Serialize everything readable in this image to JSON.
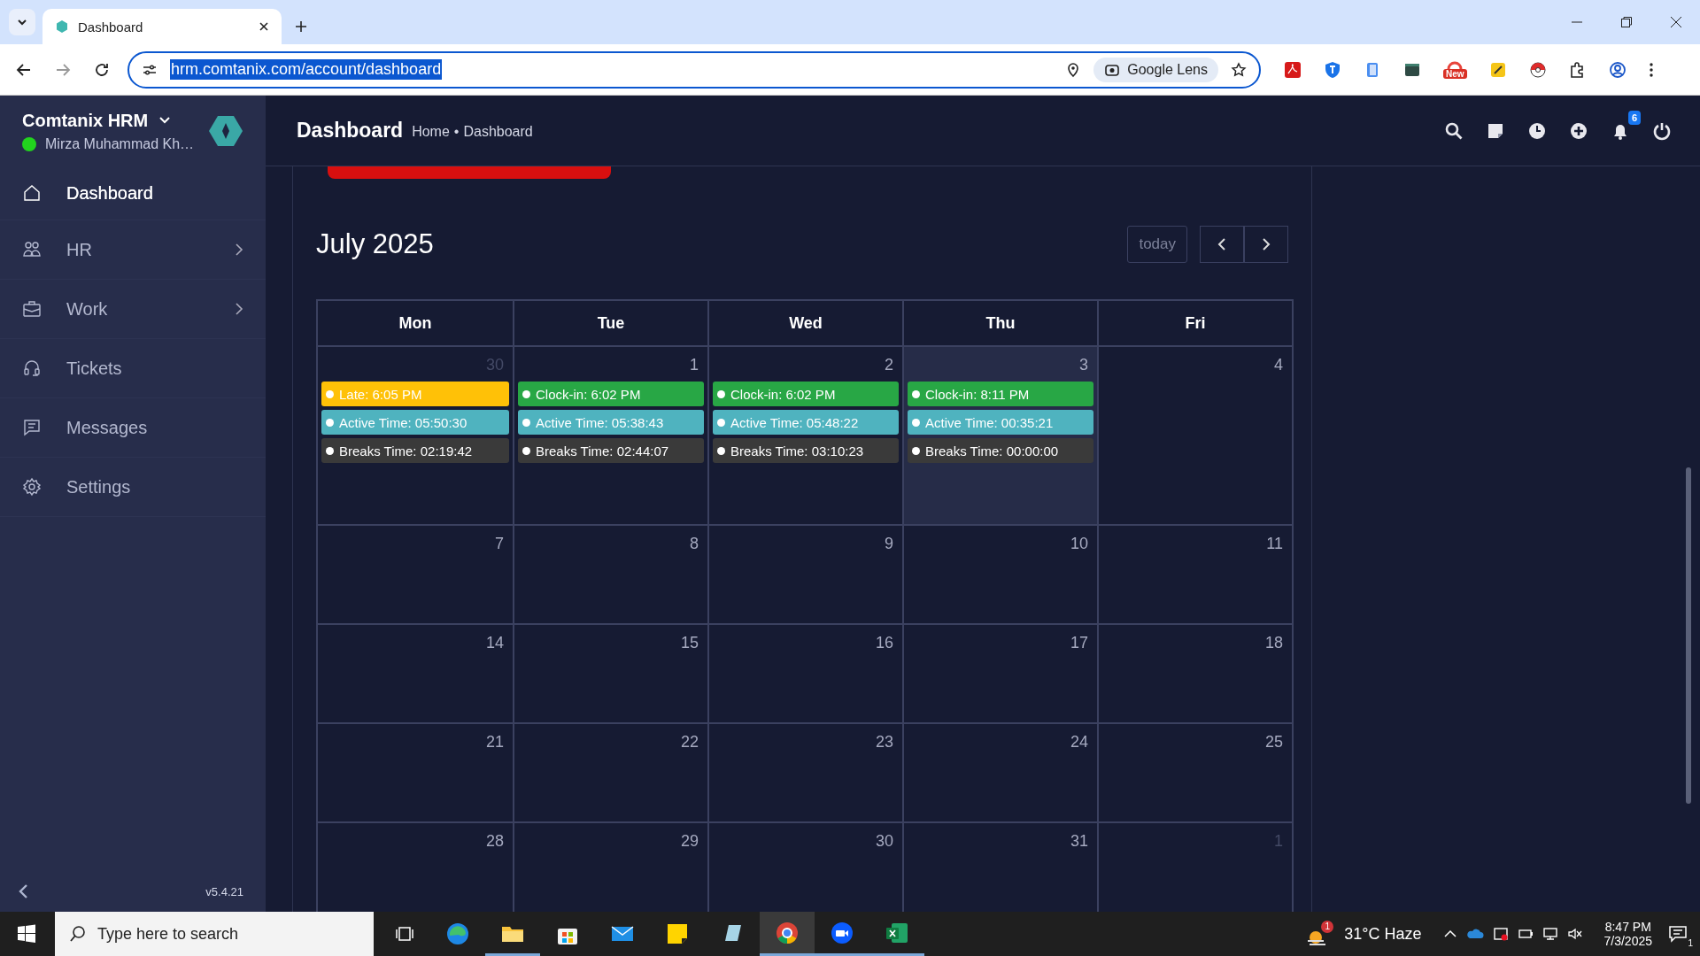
{
  "browser": {
    "tabs": [
      {
        "title": "Dashboard",
        "selected": true
      }
    ],
    "address": "hrm.comtanix.com/account/dashboard",
    "lens_label": "Google Lens",
    "extension_badge": "New"
  },
  "sidebar": {
    "brand": "Comtanix HRM",
    "user": "Mirza Muhammad Kh…",
    "online": true,
    "items": [
      {
        "label": "Dashboard",
        "selected": true,
        "has_submenu": false
      },
      {
        "label": "HR",
        "selected": false,
        "has_submenu": true
      },
      {
        "label": "Work",
        "selected": false,
        "has_submenu": true
      },
      {
        "label": "Tickets",
        "selected": false,
        "has_submenu": false
      },
      {
        "label": "Messages",
        "selected": false,
        "has_submenu": false
      },
      {
        "label": "Settings",
        "selected": false,
        "has_submenu": false
      }
    ],
    "version": "v5.4.21"
  },
  "header": {
    "title": "Dashboard",
    "breadcrumb": {
      "items": [
        "Home",
        "Dashboard"
      ],
      "separator": "•"
    },
    "notification_count": "6"
  },
  "calendar": {
    "title": "July 2025",
    "today_button": {
      "label": "today",
      "disabled": true
    },
    "weekdays": [
      "Mon",
      "Tue",
      "Wed",
      "Thu",
      "Fri"
    ],
    "weeks": [
      {
        "days": [
          {
            "number": "30",
            "muted": true,
            "today": false,
            "events": [
              {
                "text": "Late: 6:05 PM",
                "color": "#ffc107"
              },
              {
                "text": "Active Time: 05:50:30",
                "color": "#4fb3bf"
              },
              {
                "text": "Breaks Time: 02:19:42",
                "color": "#3a3a3a"
              }
            ]
          },
          {
            "number": "1",
            "muted": false,
            "today": false,
            "events": [
              {
                "text": "Clock-in: 6:02 PM",
                "color": "#28a745"
              },
              {
                "text": "Active Time: 05:38:43",
                "color": "#4fb3bf"
              },
              {
                "text": "Breaks Time: 02:44:07",
                "color": "#3a3a3a"
              }
            ]
          },
          {
            "number": "2",
            "muted": false,
            "today": false,
            "events": [
              {
                "text": "Clock-in: 6:02 PM",
                "color": "#28a745"
              },
              {
                "text": "Active Time: 05:48:22",
                "color": "#4fb3bf"
              },
              {
                "text": "Breaks Time: 03:10:23",
                "color": "#3a3a3a"
              }
            ]
          },
          {
            "number": "3",
            "muted": false,
            "today": true,
            "events": [
              {
                "text": "Clock-in: 8:11 PM",
                "color": "#28a745"
              },
              {
                "text": "Active Time: 00:35:21",
                "color": "#4fb3bf"
              },
              {
                "text": "Breaks Time: 00:00:00",
                "color": "#3a3a3a"
              }
            ]
          },
          {
            "number": "4",
            "muted": false,
            "today": false
          }
        ]
      },
      {
        "days": [
          {
            "number": "7",
            "muted": false,
            "today": false
          },
          {
            "number": "8",
            "muted": false,
            "today": false
          },
          {
            "number": "9",
            "muted": false,
            "today": false
          },
          {
            "number": "10",
            "muted": false,
            "today": false
          },
          {
            "number": "11",
            "muted": false,
            "today": false
          }
        ]
      },
      {
        "days": [
          {
            "number": "14",
            "muted": false,
            "today": false
          },
          {
            "number": "15",
            "muted": false,
            "today": false
          },
          {
            "number": "16",
            "muted": false,
            "today": false
          },
          {
            "number": "17",
            "muted": false,
            "today": false
          },
          {
            "number": "18",
            "muted": false,
            "today": false
          }
        ]
      },
      {
        "days": [
          {
            "number": "21",
            "muted": false,
            "today": false
          },
          {
            "number": "22",
            "muted": false,
            "today": false
          },
          {
            "number": "23",
            "muted": false,
            "today": false
          },
          {
            "number": "24",
            "muted": false,
            "today": false
          },
          {
            "number": "25",
            "muted": false,
            "today": false
          }
        ]
      },
      {
        "days": [
          {
            "number": "28",
            "muted": false,
            "today": false
          },
          {
            "number": "29",
            "muted": false,
            "today": false
          },
          {
            "number": "30",
            "muted": false,
            "today": false
          },
          {
            "number": "31",
            "muted": false,
            "today": false
          },
          {
            "number": "1",
            "muted": true,
            "today": false
          }
        ]
      }
    ]
  },
  "taskbar": {
    "search_placeholder": "Type here to search",
    "weather_badge": "1",
    "weather": "31°C Haze",
    "time": "8:47 PM",
    "date": "7/3/2025",
    "notifications": "1"
  }
}
